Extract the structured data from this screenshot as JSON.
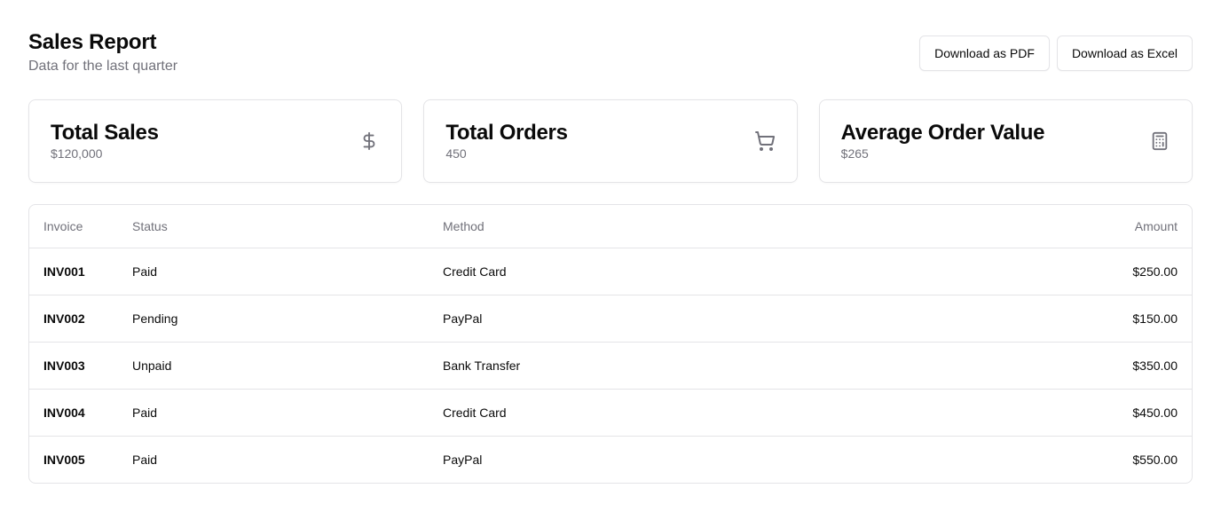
{
  "header": {
    "title": "Sales Report",
    "subtitle": "Data for the last quarter",
    "pdf_label": "Download as PDF",
    "excel_label": "Download as Excel"
  },
  "cards": [
    {
      "title": "Total Sales",
      "value": "$120,000",
      "icon": "dollar-icon"
    },
    {
      "title": "Total Orders",
      "value": "450",
      "icon": "cart-icon"
    },
    {
      "title": "Average Order Value",
      "value": "$265",
      "icon": "calculator-icon"
    }
  ],
  "table": {
    "headers": {
      "invoice": "Invoice",
      "status": "Status",
      "method": "Method",
      "amount": "Amount"
    },
    "rows": [
      {
        "invoice": "INV001",
        "status": "Paid",
        "method": "Credit Card",
        "amount": "$250.00"
      },
      {
        "invoice": "INV002",
        "status": "Pending",
        "method": "PayPal",
        "amount": "$150.00"
      },
      {
        "invoice": "INV003",
        "status": "Unpaid",
        "method": "Bank Transfer",
        "amount": "$350.00"
      },
      {
        "invoice": "INV004",
        "status": "Paid",
        "method": "Credit Card",
        "amount": "$450.00"
      },
      {
        "invoice": "INV005",
        "status": "Paid",
        "method": "PayPal",
        "amount": "$550.00"
      }
    ]
  },
  "colors": {
    "text": "#0a0a0a",
    "muted": "#71717a",
    "border": "#e4e4e7"
  }
}
